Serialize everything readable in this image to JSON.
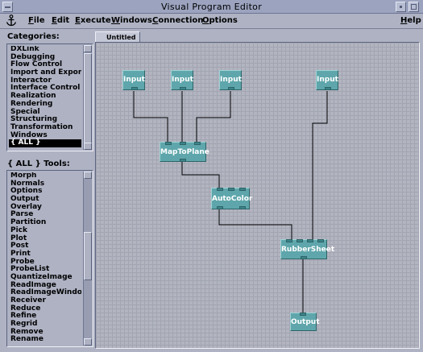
{
  "window": {
    "title": "Visual Program Editor"
  },
  "menu": {
    "items": [
      "File",
      "Edit",
      "Execute",
      "Windows",
      "Connection",
      "Options"
    ],
    "help": "Help"
  },
  "categories": {
    "label": "Categories:",
    "items": [
      "DXLink",
      "Debugging",
      "Flow Control",
      "Import and Export",
      "Interactor",
      "Interface Control",
      "Realization",
      "Rendering",
      "Special",
      "Structuring",
      "Transformation",
      "Windows",
      "{ ALL }"
    ],
    "selected": "{ ALL }"
  },
  "tools": {
    "label": "{ ALL } Tools:",
    "items": [
      "Morph",
      "Normals",
      "Options",
      "Output",
      "Overlay",
      "Parse",
      "Partition",
      "Pick",
      "Plot",
      "Post",
      "Print",
      "Probe",
      "ProbeList",
      "QuantizeImage",
      "ReadImage",
      "ReadImageWindow",
      "Receiver",
      "Reduce",
      "Refine",
      "Regrid",
      "Remove",
      "Rename"
    ]
  },
  "canvas": {
    "tab_label": "Untitled",
    "nodes": [
      "Input",
      "Input",
      "Input",
      "Input",
      "MapToPlane",
      "AutoColor",
      "RubberSheet",
      "Output"
    ]
  },
  "colors": {
    "node": "#5ea6ab",
    "node_dark": "#2d6468",
    "wire": "#000000",
    "background": "#aeb2c3"
  }
}
